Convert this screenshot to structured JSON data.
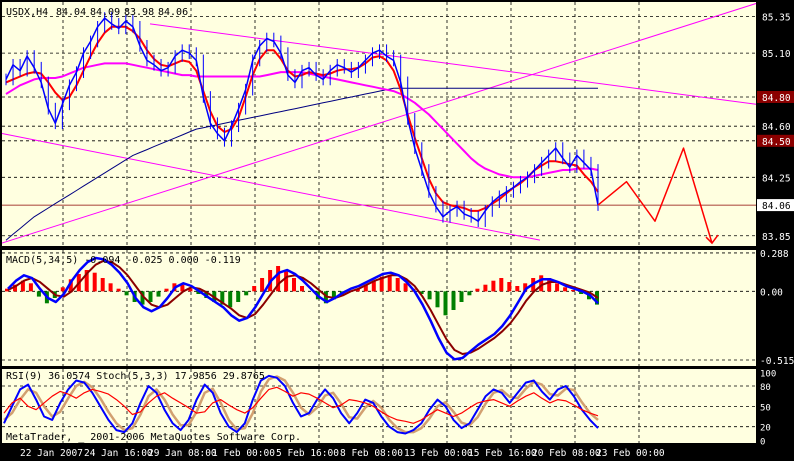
{
  "chart_data": {
    "type": "line",
    "panels": [
      {
        "id": "price",
        "title": "USDX,H4",
        "ohlc": [
          "84.04",
          "84.09",
          "83.98",
          "84.06"
        ],
        "ylim": [
          83.78,
          85.45
        ],
        "ticks": [
          "85.35",
          "85.10",
          "84.80",
          "84.60",
          "84.50",
          "84.25",
          "84.06",
          "83.85"
        ],
        "highlighted_ticks": [
          "84.80",
          "84.50",
          "84.06"
        ],
        "series": {
          "close": [
            84.92,
            85.02,
            84.98,
            85.08,
            85.0,
            84.9,
            84.72,
            84.62,
            84.75,
            84.88,
            84.97,
            85.1,
            85.18,
            85.28,
            85.34,
            85.3,
            85.27,
            85.32,
            85.28,
            85.15,
            85.05,
            85.02,
            84.98,
            85.0,
            85.08,
            85.12,
            85.1,
            85.05,
            84.8,
            84.62,
            84.55,
            84.5,
            84.6,
            84.72,
            84.85,
            85.05,
            85.15,
            85.2,
            85.18,
            85.1,
            84.95,
            84.9,
            84.98,
            85.0,
            84.95,
            84.92,
            84.98,
            85.02,
            85.0,
            84.97,
            85.0,
            85.05,
            85.1,
            85.12,
            85.08,
            85.05,
            84.9,
            84.65,
            84.45,
            84.3,
            84.15,
            84.05,
            83.98,
            84.02,
            84.05,
            84.0,
            83.98,
            83.95,
            84.02,
            84.08,
            84.12,
            84.15,
            84.18,
            84.22,
            84.25,
            84.3,
            84.35,
            84.4,
            84.45,
            84.38,
            84.32,
            84.4,
            84.35,
            84.3,
            84.06
          ],
          "ma_fast": [
            84.9,
            84.92,
            84.94,
            84.96,
            84.97,
            84.96,
            84.9,
            84.83,
            84.78,
            84.8,
            84.88,
            84.98,
            85.08,
            85.17,
            85.24,
            85.28,
            85.28,
            85.28,
            85.25,
            85.2,
            85.12,
            85.06,
            85.02,
            85.01,
            85.03,
            85.05,
            85.04,
            84.98,
            84.84,
            84.7,
            84.6,
            84.56,
            84.58,
            84.66,
            84.8,
            84.95,
            85.06,
            85.12,
            85.12,
            85.06,
            84.98,
            84.94,
            84.95,
            84.97,
            84.96,
            84.95,
            84.96,
            84.98,
            84.99,
            84.99,
            85.0,
            85.03,
            85.07,
            85.08,
            85.05,
            84.98,
            84.85,
            84.68,
            84.52,
            84.38,
            84.24,
            84.14,
            84.08,
            84.06,
            84.05,
            84.04,
            84.02,
            84.02,
            84.04,
            84.07,
            84.1,
            84.14,
            84.18,
            84.21,
            84.25,
            84.3,
            84.33,
            84.36,
            84.36,
            84.35,
            84.34,
            84.33,
            84.27,
            84.22,
            84.15
          ],
          "ma_slow": [
            84.82,
            84.85,
            84.88,
            84.9,
            84.92,
            84.93,
            84.93,
            84.93,
            84.94,
            84.96,
            84.98,
            85.0,
            85.01,
            85.02,
            85.03,
            85.03,
            85.03,
            85.03,
            85.02,
            85.01,
            85.0,
            84.99,
            84.98,
            84.97,
            84.96,
            84.95,
            84.95,
            84.94,
            84.94,
            84.94,
            84.94,
            84.94,
            84.94,
            84.94,
            84.94,
            84.94,
            84.94,
            84.95,
            84.96,
            84.97,
            84.97,
            84.97,
            84.97,
            84.96,
            84.95,
            84.94,
            84.93,
            84.92,
            84.91,
            84.9,
            84.89,
            84.88,
            84.87,
            84.86,
            84.85,
            84.84,
            84.82,
            84.79,
            84.76,
            84.72,
            84.68,
            84.63,
            84.58,
            84.53,
            84.48,
            84.43,
            84.38,
            84.34,
            84.31,
            84.29,
            84.27,
            84.26,
            84.25,
            84.25,
            84.25,
            84.26,
            84.27,
            84.28,
            84.29,
            84.3,
            84.3,
            84.31,
            84.31,
            84.31,
            84.3
          ],
          "ma_long": [
            83.82,
            83.86,
            83.9,
            83.94,
            83.98,
            84.01,
            84.04,
            84.07,
            84.1,
            84.13,
            84.16,
            84.19,
            84.22,
            84.25,
            84.28,
            84.31,
            84.34,
            84.37,
            84.4,
            84.42,
            84.44,
            84.46,
            84.48,
            84.5,
            84.52,
            84.54,
            84.56,
            84.58,
            84.59,
            84.6,
            84.61,
            84.62,
            84.63,
            84.64,
            84.65,
            84.66,
            84.67,
            84.68,
            84.69,
            84.7,
            84.71,
            84.72,
            84.73,
            84.74,
            84.75,
            84.76,
            84.77,
            84.78,
            84.79,
            84.8,
            84.81,
            84.82,
            84.83,
            84.84,
            84.85,
            84.86,
            84.86,
            84.86,
            84.86,
            84.86,
            84.86,
            84.86,
            84.86,
            84.86,
            84.86,
            84.86,
            84.86,
            84.86,
            84.86,
            84.86,
            84.86,
            84.86,
            84.86,
            84.86,
            84.86,
            84.86,
            84.86,
            84.86,
            84.86,
            84.86,
            84.86,
            84.86,
            84.86,
            84.86,
            84.86
          ],
          "projection": [
            84.06,
            84.22,
            83.95,
            84.45,
            83.8
          ]
        }
      },
      {
        "id": "macd",
        "title": "MACD(5,34,5) -0.094 -0.025 0.000 -0.119",
        "ylim": [
          -0.56,
          0.31
        ],
        "ticks": [
          "0.288",
          "0.00",
          "-0.515"
        ],
        "series": {
          "histogram": [
            0.02,
            0.05,
            0.08,
            0.06,
            -0.04,
            -0.09,
            -0.05,
            0.03,
            0.09,
            0.13,
            0.16,
            0.14,
            0.1,
            0.06,
            0.02,
            -0.03,
            -0.08,
            -0.1,
            -0.08,
            -0.04,
            0.02,
            0.06,
            0.05,
            0.02,
            -0.02,
            -0.05,
            -0.08,
            -0.1,
            -0.12,
            -0.08,
            -0.03,
            0.04,
            0.1,
            0.16,
            0.19,
            0.15,
            0.1,
            0.04,
            0.0,
            -0.06,
            -0.09,
            -0.06,
            -0.03,
            0.0,
            0.02,
            0.05,
            0.08,
            0.11,
            0.12,
            0.1,
            0.06,
            0.02,
            -0.02,
            -0.06,
            -0.12,
            -0.18,
            -0.14,
            -0.08,
            -0.03,
            0.02,
            0.05,
            0.08,
            0.1,
            0.07,
            0.04,
            0.06,
            0.1,
            0.12,
            0.1,
            0.06,
            0.03,
            0.01,
            -0.02,
            -0.06,
            -0.1
          ],
          "macd": [
            0.02,
            0.08,
            0.12,
            0.1,
            0.02,
            -0.05,
            -0.08,
            -0.02,
            0.08,
            0.16,
            0.22,
            0.25,
            0.24,
            0.2,
            0.14,
            0.06,
            -0.05,
            -0.12,
            -0.15,
            -0.12,
            -0.05,
            0.03,
            0.06,
            0.04,
            0.0,
            -0.04,
            -0.08,
            -0.12,
            -0.18,
            -0.22,
            -0.2,
            -0.12,
            -0.02,
            0.08,
            0.14,
            0.16,
            0.13,
            0.08,
            0.02,
            -0.04,
            -0.08,
            -0.05,
            -0.01,
            0.02,
            0.04,
            0.07,
            0.1,
            0.13,
            0.14,
            0.12,
            0.07,
            0.0,
            -0.1,
            -0.22,
            -0.35,
            -0.46,
            -0.51,
            -0.5,
            -0.45,
            -0.4,
            -0.36,
            -0.32,
            -0.26,
            -0.18,
            -0.08,
            0.02,
            0.06,
            0.09,
            0.09,
            0.07,
            0.04,
            0.02,
            0.0,
            -0.03,
            -0.09
          ],
          "signal": [
            0.01,
            0.04,
            0.08,
            0.1,
            0.07,
            0.02,
            -0.03,
            -0.04,
            0.0,
            0.07,
            0.14,
            0.2,
            0.23,
            0.22,
            0.18,
            0.12,
            0.04,
            -0.04,
            -0.1,
            -0.12,
            -0.1,
            -0.05,
            0.0,
            0.03,
            0.02,
            -0.01,
            -0.05,
            -0.09,
            -0.13,
            -0.18,
            -0.2,
            -0.17,
            -0.1,
            -0.02,
            0.06,
            0.11,
            0.12,
            0.1,
            0.06,
            0.01,
            -0.04,
            -0.05,
            -0.03,
            0.0,
            0.02,
            0.05,
            0.08,
            0.1,
            0.12,
            0.12,
            0.09,
            0.04,
            -0.04,
            -0.14,
            -0.25,
            -0.36,
            -0.44,
            -0.47,
            -0.46,
            -0.43,
            -0.39,
            -0.35,
            -0.3,
            -0.24,
            -0.16,
            -0.07,
            0.0,
            0.05,
            0.07,
            0.07,
            0.05,
            0.03,
            0.01,
            -0.01,
            -0.05
          ]
        }
      },
      {
        "id": "oscillators",
        "title": "RSI(9) 36.0574  Stoch(5,3,3) 17.9856 29.8765",
        "ylim": [
          -4,
          105
        ],
        "ticks": [
          "100",
          "80",
          "50",
          "20",
          "0"
        ],
        "series": {
          "rsi": [
            40,
            55,
            62,
            50,
            45,
            55,
            65,
            72,
            68,
            62,
            70,
            75,
            72,
            68,
            60,
            50,
            38,
            42,
            55,
            65,
            70,
            62,
            55,
            48,
            40,
            42,
            55,
            60,
            52,
            45,
            40,
            48,
            62,
            75,
            78,
            72,
            65,
            70,
            68,
            62,
            55,
            48,
            52,
            60,
            58,
            55,
            50,
            42,
            35,
            30,
            28,
            25,
            30,
            38,
            45,
            40,
            35,
            40,
            48,
            55,
            58,
            60,
            55,
            50,
            58,
            65,
            70,
            62,
            55,
            60,
            58,
            52,
            45,
            40,
            36
          ],
          "stoch_main": [
            25,
            50,
            75,
            82,
            60,
            35,
            30,
            55,
            75,
            88,
            85,
            70,
            50,
            30,
            15,
            12,
            25,
            55,
            80,
            70,
            45,
            25,
            15,
            30,
            60,
            82,
            70,
            40,
            20,
            12,
            25,
            60,
            88,
            95,
            92,
            80,
            55,
            35,
            40,
            60,
            75,
            62,
            40,
            25,
            40,
            60,
            55,
            35,
            20,
            12,
            10,
            15,
            25,
            45,
            60,
            50,
            30,
            18,
            25,
            45,
            65,
            75,
            70,
            55,
            70,
            85,
            88,
            72,
            60,
            75,
            80,
            65,
            45,
            30,
            18
          ],
          "stoch_signal": [
            30,
            40,
            60,
            75,
            70,
            50,
            35,
            42,
            62,
            80,
            86,
            78,
            62,
            42,
            25,
            15,
            18,
            38,
            65,
            75,
            60,
            38,
            22,
            22,
            42,
            70,
            76,
            55,
            30,
            16,
            18,
            40,
            72,
            90,
            94,
            88,
            70,
            48,
            38,
            48,
            66,
            70,
            54,
            34,
            32,
            48,
            58,
            48,
            30,
            18,
            12,
            12,
            18,
            32,
            50,
            56,
            42,
            26,
            22,
            34,
            54,
            70,
            74,
            64,
            62,
            76,
            86,
            82,
            68,
            66,
            76,
            74,
            56,
            40,
            30
          ]
        }
      }
    ],
    "x_tick_labels": [
      "22 Jan 2007",
      "24 Jan 16:00",
      "29 Jan 08:00",
      "1 Feb 00:00",
      "5 Feb 16:00",
      "8 Feb 08:00",
      "13 Feb 00:00",
      "15 Feb 16:00",
      "20 Feb 08:00",
      "23 Feb 00:00"
    ],
    "footer_text": "MetaTrader, _ 2001-2006 MetaQuotes Software Corp.",
    "grid": true,
    "colors": {
      "background": "#000000",
      "plot_area": "#ffffe0",
      "axis_tick_labels": "#ffffff",
      "text": "#000000",
      "price_close": "#0000ff",
      "ma_fast": "#ff0000",
      "ma_slow": "#800000",
      "ma_long": "#000080",
      "moving_average_magenta": "#ff00ff",
      "trendlines": "#ff00ff",
      "projection": "#ff0000",
      "macd_positive": "#ff0000",
      "macd_negative": "#008000",
      "macd_line": "#0000ff",
      "macd_signal": "#8b0000",
      "rsi": "#ff0000",
      "stoch_main": "#0000ff",
      "stoch_signal": "#d2a070",
      "level_tag": "#8b0000"
    }
  }
}
